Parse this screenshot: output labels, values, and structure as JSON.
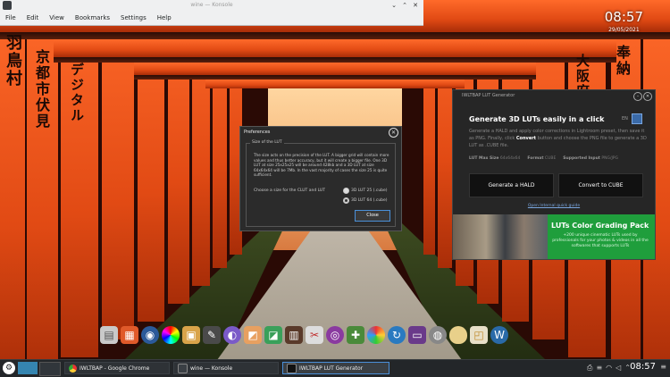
{
  "konsole": {
    "title": "wine — Konsole",
    "menu": [
      "File",
      "Edit",
      "View",
      "Bookmarks",
      "Settings",
      "Help"
    ]
  },
  "clock": {
    "time": "08:57",
    "date": "29/05/2021"
  },
  "preferences": {
    "title": "Preferences",
    "group_label": "Size of the LUT",
    "description": "The size acts on the precision of the LUT. A bigger grid will contain more values and thus better accuracy, but it will create a bigger file. One 3D LUT at size 25x25x25 will be around 428kb and a 3D LUT at size 64x64x64 will be 7Mb. In the vast majority of cases the size 25 is quite sufficient.",
    "choose_label": "Choose a size for the CLUT and LUT",
    "options": [
      "3D LUT 25 (.cube)",
      "3D LUT 64 (.cube)"
    ],
    "selected": "3D LUT 64 (.cube)",
    "close_label": "Close"
  },
  "lut_app": {
    "title": "IWLTBAP LUT Generator",
    "heading": "Generate 3D LUTs easily in a click",
    "lang_label": "EN",
    "lead": "Generate a HALD and apply color corrections in Lightroom preset, then save it as PNG. Finally, click",
    "lead_bold": "Convert",
    "lead_tail": "button and choose the PNG file to generate a 3D LUT as .CUBE file.",
    "stats": [
      {
        "label": "LUT Max Size",
        "value": "64x64x64"
      },
      {
        "label": "Format",
        "value": "CUBE"
      },
      {
        "label": "Supported Input",
        "value": "PNG/JPG"
      }
    ],
    "buttons": [
      "Generate a HALD",
      "Convert to CUBE"
    ],
    "guide_link": "Open Internal quick guide",
    "promo": {
      "title": "LUTs Color Grading Pack",
      "subtitle": "+200 unique cinematic LUTs used by professionals for your photos & videos in all the softwares that supports LUTs"
    }
  },
  "taskbar": {
    "tasks": [
      {
        "label": "IWLTBAP - Google Chrome",
        "active": false
      },
      {
        "label": "wine — Konsole",
        "active": false
      },
      {
        "label": "IWLTBAP LUT Generator",
        "active": true
      }
    ],
    "time": "08:57"
  },
  "dock_icons": [
    "files-icon",
    "office-icon",
    "browser-icon",
    "color-wheel-icon",
    "photo-icon",
    "paint-icon",
    "palette-icon",
    "image-editor-icon",
    "draw-icon",
    "book-icon",
    "tools-icon",
    "eye-icon",
    "puzzle-icon",
    "circle-icon",
    "swirl-icon",
    "film-icon",
    "cd-icon",
    "egg-icon",
    "frame-icon",
    "wordpress-icon"
  ],
  "colors": {
    "accent": "#3daee9",
    "promo_green": "#1f9e3c",
    "torii_orange": "#e14a14"
  }
}
